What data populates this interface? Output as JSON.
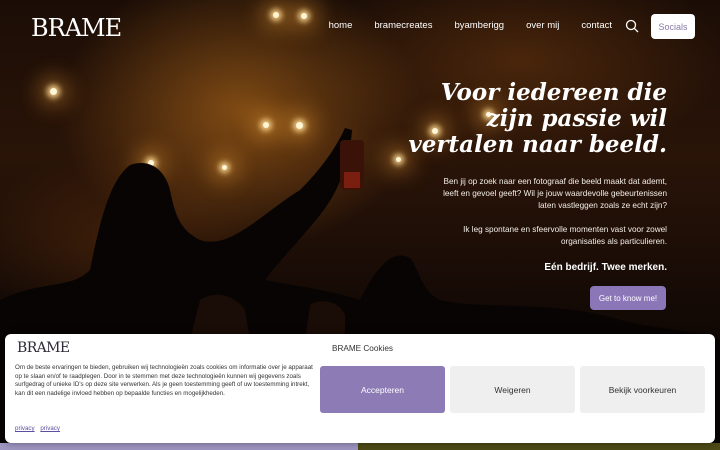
{
  "header": {
    "logo": "BRAME",
    "nav": [
      "home",
      "bramecreates",
      "byamberigg",
      "over mij",
      "contact"
    ],
    "search_icon": "search-icon",
    "socials_label": "Socials"
  },
  "hero": {
    "headline": "Voor iedereen die zijn passie wil vertalen naar beeld.",
    "paragraph1": "Ben jij op zoek naar een fotograaf die beeld maakt dat ademt, leeft en gevoel geeft? Wil je jouw waardevolle gebeurtenissen laten vastleggen zoals ze echt zijn?",
    "paragraph2": "Ik leg spontane en sfeervolle momenten vast voor zowel organisaties als particulieren.",
    "tagline": "Eén bedrijf. Twee merken.",
    "cta_label": "Get to know me!"
  },
  "cookie": {
    "logo": "BRAME",
    "title": "BRAME Cookies",
    "text": "Om de beste ervaringen te bieden, gebruiken wij technologieën zoals cookies om informatie over je apparaat op te slaan en/of te raadplegen. Door in te stemmen met deze technologieën kunnen wij gegevens zoals surfgedrag of unieke ID's op deze site verwerken. Als je geen toestemming geeft of uw toestemming intrekt, kan dit een nadelige invloed hebben op bepaalde functies en mogelijkheden.",
    "link1": "privacy",
    "link2": "privacy",
    "accept_label": "Accepteren",
    "deny_label": "Weigeren",
    "prefs_label": "Bekijk voorkeuren"
  },
  "colors": {
    "accent": "#8b77b8",
    "strip_left": "#9f95c2",
    "strip_right": "#4e4a16"
  }
}
